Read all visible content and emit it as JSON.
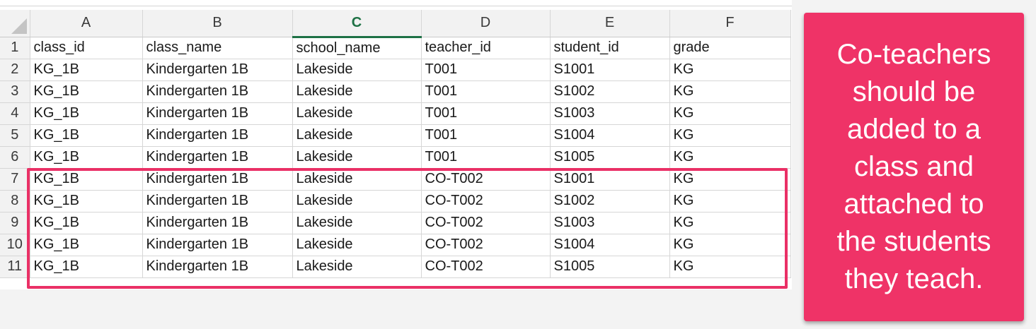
{
  "columns": [
    "A",
    "B",
    "C",
    "D",
    "E",
    "F"
  ],
  "selected_column": "C",
  "rows": [
    {
      "num": "1",
      "cells": [
        "class_id",
        "class_name",
        "school_name",
        "teacher_id",
        "student_id",
        "grade"
      ]
    },
    {
      "num": "2",
      "cells": [
        "KG_1B",
        "Kindergarten 1B",
        "Lakeside",
        "T001",
        "S1001",
        "KG"
      ]
    },
    {
      "num": "3",
      "cells": [
        "KG_1B",
        "Kindergarten 1B",
        "Lakeside",
        "T001",
        "S1002",
        "KG"
      ]
    },
    {
      "num": "4",
      "cells": [
        "KG_1B",
        "Kindergarten 1B",
        "Lakeside",
        "T001",
        "S1003",
        "KG"
      ]
    },
    {
      "num": "5",
      "cells": [
        "KG_1B",
        "Kindergarten 1B",
        "Lakeside",
        "T001",
        "S1004",
        "KG"
      ]
    },
    {
      "num": "6",
      "cells": [
        "KG_1B",
        "Kindergarten 1B",
        "Lakeside",
        "T001",
        "S1005",
        "KG"
      ]
    },
    {
      "num": "7",
      "cells": [
        "KG_1B",
        "Kindergarten 1B",
        "Lakeside",
        "CO-T002",
        "S1001",
        "KG"
      ]
    },
    {
      "num": "8",
      "cells": [
        "KG_1B",
        "Kindergarten 1B",
        "Lakeside",
        "CO-T002",
        "S1002",
        "KG"
      ]
    },
    {
      "num": "9",
      "cells": [
        "KG_1B",
        "Kindergarten 1B",
        "Lakeside",
        "CO-T002",
        "S1003",
        "KG"
      ]
    },
    {
      "num": "10",
      "cells": [
        "KG_1B",
        "Kindergarten 1B",
        "Lakeside",
        "CO-T002",
        "S1004",
        "KG"
      ]
    },
    {
      "num": "11",
      "cells": [
        "KG_1B",
        "Kindergarten 1B",
        "Lakeside",
        "CO-T002",
        "S1005",
        "KG"
      ]
    }
  ],
  "callout": {
    "text": "Co-teachers should be added to a class and attached to the students they teach."
  },
  "colors": {
    "highlight": "#ea3066",
    "callout_bg": "#ef3367",
    "selected_header": "#1e7145"
  }
}
